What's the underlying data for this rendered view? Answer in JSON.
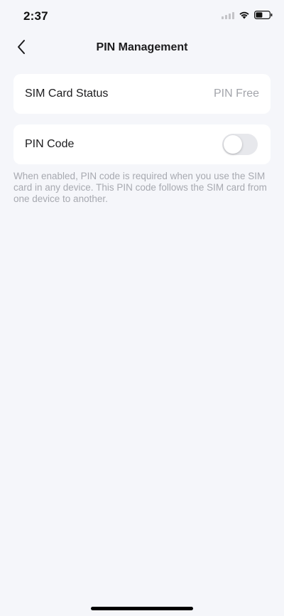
{
  "status_bar": {
    "time": "2:37",
    "icons": [
      "signal-icon",
      "wifi-icon",
      "battery-icon"
    ]
  },
  "nav": {
    "title": "PIN Management",
    "back_icon": "chevron-left-icon"
  },
  "sim_status": {
    "label": "SIM Card Status",
    "value": "PIN Free"
  },
  "pin_code": {
    "label": "PIN Code",
    "enabled": false
  },
  "description": "When enabled, PIN code is required when you use the SIM card in any device. This PIN code follows the SIM card from one device to another.",
  "colors": {
    "background": "#f5f6fa",
    "card": "#ffffff",
    "muted_text": "#a3a5ab",
    "toggle_off": "#e7e8ec"
  }
}
